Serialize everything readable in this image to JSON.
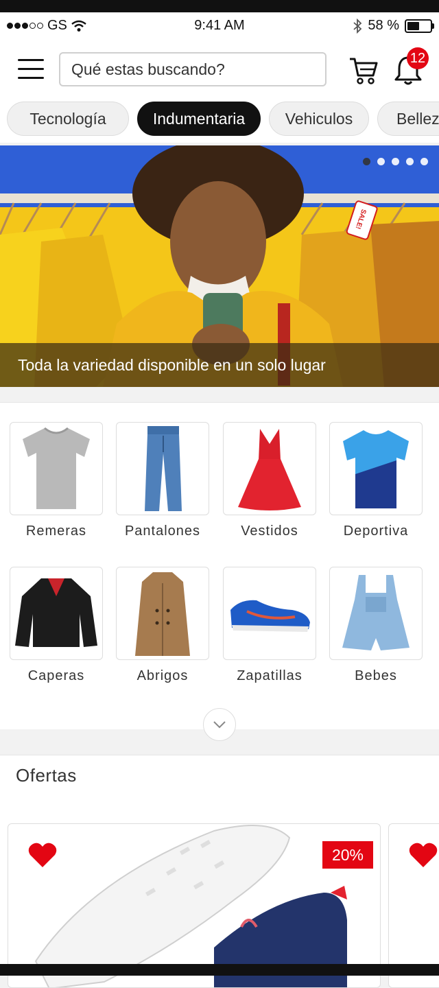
{
  "status_bar": {
    "carrier": "GS",
    "time": "9:41 AM",
    "battery": "58 %",
    "battery_level": 0.58
  },
  "header": {
    "search_placeholder": "Qué estas buscando?",
    "notifications_count": "12",
    "icons": [
      "menu-icon",
      "cart-icon",
      "bell-icon"
    ]
  },
  "categories": [
    {
      "label": "Tecnología",
      "active": false
    },
    {
      "label": "Indumentaria",
      "active": true
    },
    {
      "label": "Vehiculos",
      "active": false
    },
    {
      "label": "Belleza",
      "active": false
    }
  ],
  "banner": {
    "caption": "Toda la variedad disponible en un solo lugar",
    "sale_tag": "SALE!",
    "slides": 5,
    "active_slide": 1
  },
  "product_categories": [
    {
      "label": "Remeras",
      "icon": "tshirt"
    },
    {
      "label": "Pantalones",
      "icon": "jeans"
    },
    {
      "label": "Vestidos",
      "icon": "dress"
    },
    {
      "label": "Deportiva",
      "icon": "sport-shirt"
    },
    {
      "label": "Caperas",
      "icon": "leather-jacket"
    },
    {
      "label": "Abrigos",
      "icon": "coat"
    },
    {
      "label": "Zapatillas",
      "icon": "sneakers"
    },
    {
      "label": "Bebes",
      "icon": "baby-overalls"
    }
  ],
  "offers": {
    "title": "Ofertas",
    "items": [
      {
        "discount": "20%",
        "favorite": true
      },
      {
        "favorite": true
      }
    ]
  },
  "colors": {
    "accent": "#e30613",
    "active_chip": "#111111"
  }
}
